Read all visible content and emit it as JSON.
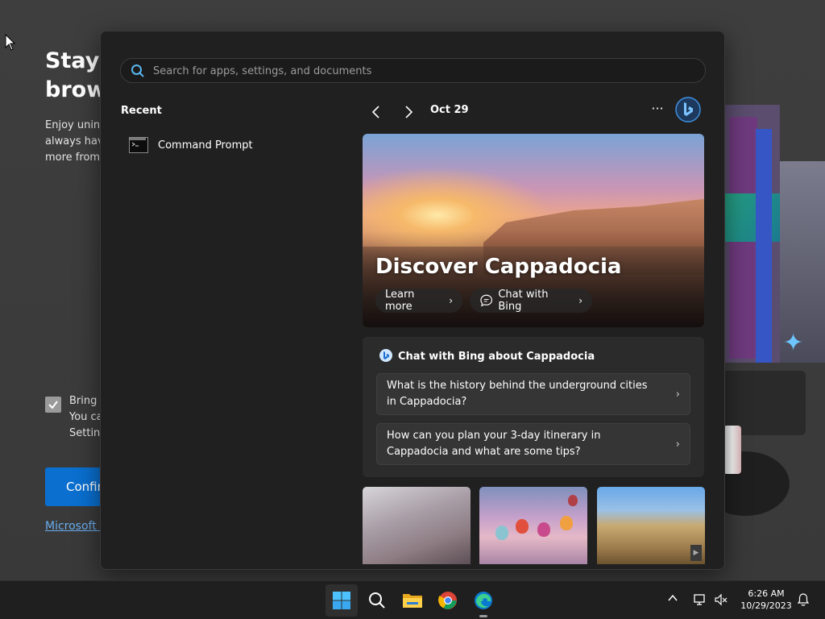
{
  "background_window": {
    "title_line1": "Stay c",
    "title_line2": "brows",
    "desc_line1": "Enjoy unint",
    "desc_line2": "always havi",
    "desc_line3": "more from",
    "checkbox_line1": "Bring c",
    "checkbox_line2": "You ca",
    "checkbox_line3": "Setting",
    "confirm_label": "Confir",
    "link_label": "Microsoft P"
  },
  "search": {
    "placeholder": "Search for apps, settings, and documents",
    "value": ""
  },
  "recent": {
    "title": "Recent",
    "items": [
      {
        "label": "Command Prompt",
        "icon": "command-prompt-icon"
      }
    ]
  },
  "highlights": {
    "date": "Oct 29",
    "more_label": "···",
    "hero_title": "Discover Cappadocia",
    "learn_more": "Learn more",
    "chat_with_bing": "Chat with Bing"
  },
  "chat_card": {
    "title": "Chat with Bing about Cappadocia",
    "questions": [
      "What is the history behind the underground cities in Cappadocia?",
      "How can you plan your 3-day itinerary in Cappadocia and what are some tips?"
    ]
  },
  "taskbar": {
    "apps": [
      "start",
      "search",
      "file-explorer",
      "chrome",
      "edge"
    ],
    "time": "6:26 AM",
    "date": "10/29/2023"
  },
  "colors": {
    "panel_bg": "#202020",
    "accent_blue": "#0a6fcf",
    "link_blue": "#6aaef0",
    "taskbar_bg": "#1f1f1f"
  }
}
